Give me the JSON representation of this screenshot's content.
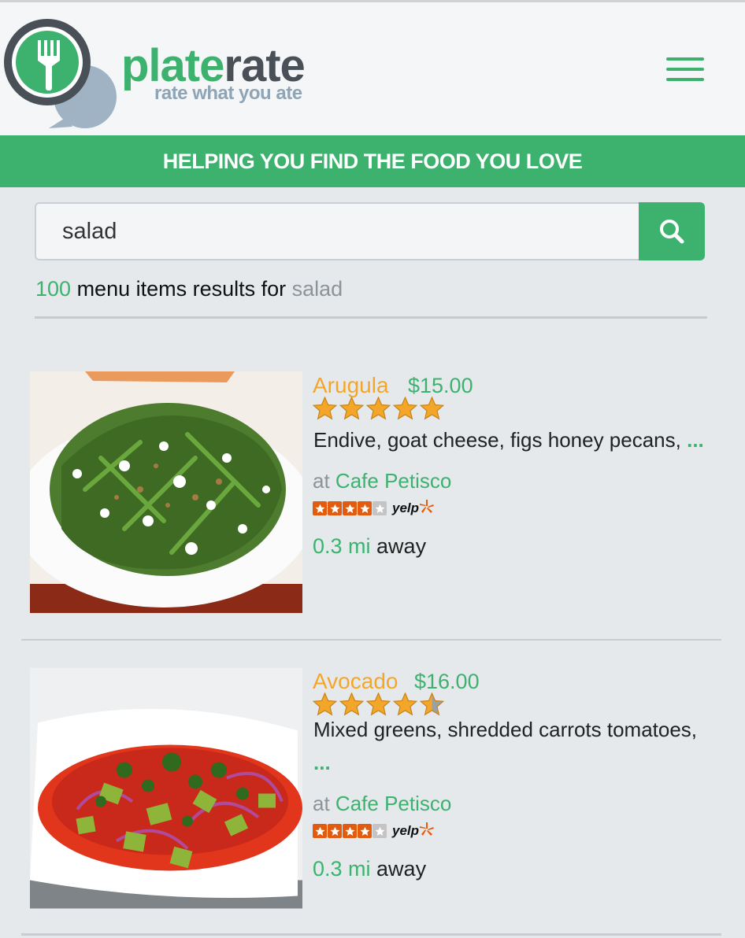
{
  "header": {
    "brand_plate": "plate",
    "brand_rate": "rate",
    "tagline": "rate what you ate"
  },
  "banner": {
    "text": "HELPING YOU FIND THE FOOD YOU LOVE"
  },
  "search": {
    "value": "salad"
  },
  "results": {
    "count": "100",
    "label": " menu items results for ",
    "term": "salad"
  },
  "items": [
    {
      "name": "Arugula",
      "price": "$15.00",
      "rating": 5,
      "description": "Endive, goat cheese, figs honey pecans, ",
      "more": "...",
      "at": "at ",
      "restaurant": "Cafe Petisco",
      "yelp_rating": 4,
      "distance": "0.3 mi",
      "away": " away"
    },
    {
      "name": "Avocado",
      "price": "$16.00",
      "rating": 4.5,
      "description": "Mixed greens, shredded carrots tomatoes, ",
      "more": "...",
      "at": "at ",
      "restaurant": "Cafe Petisco",
      "yelp_rating": 4,
      "distance": "0.3 mi",
      "away": " away"
    }
  ],
  "colors": {
    "green": "#3db26f",
    "orange": "#f4a62a",
    "yelp_red": "#e25b0e"
  },
  "yelp_label": "yelp"
}
